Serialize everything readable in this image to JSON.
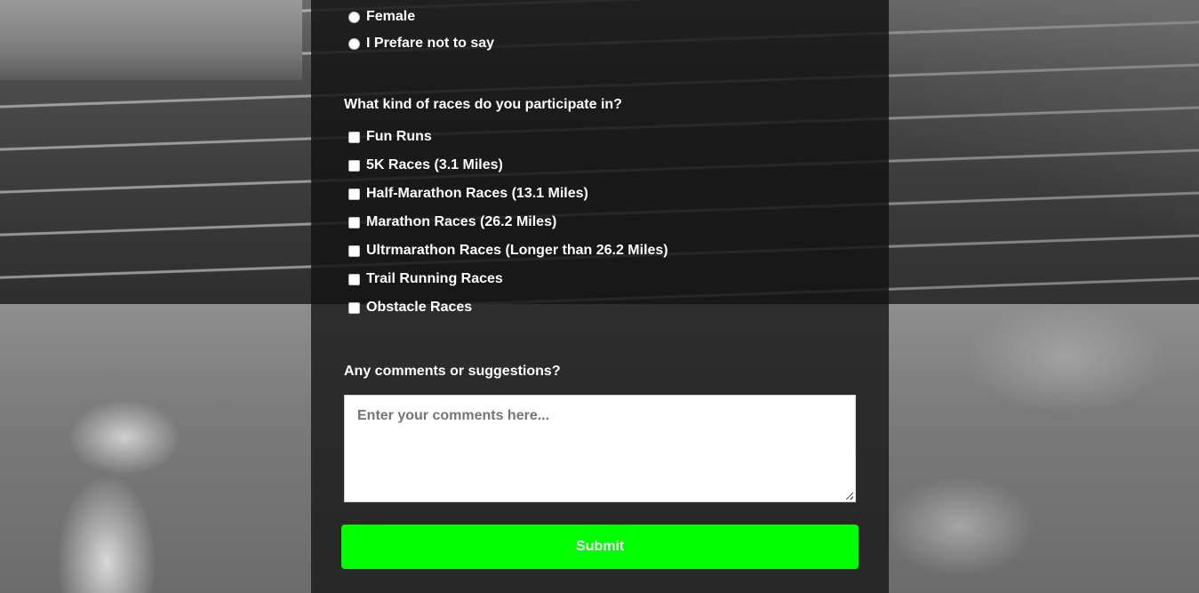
{
  "gender": {
    "options": [
      {
        "label": "Female",
        "checked": false
      },
      {
        "label": "I Prefare not to say",
        "checked": false
      }
    ]
  },
  "races": {
    "question": "What kind of races do you participate in?",
    "options": [
      {
        "label": "Fun Runs",
        "checked": false
      },
      {
        "label": "5K Races (3.1 Miles)",
        "checked": false
      },
      {
        "label": "Half-Marathon Races (13.1 Miles)",
        "checked": false
      },
      {
        "label": "Marathon Races (26.2 Miles)",
        "checked": false
      },
      {
        "label": "Ultrmarathon Races (Longer than 26.2 Miles)",
        "checked": false
      },
      {
        "label": "Trail Running Races",
        "checked": false
      },
      {
        "label": "Obstacle Races",
        "checked": false
      }
    ]
  },
  "comments": {
    "question": "Any comments or suggestions?",
    "placeholder": "Enter your comments here...",
    "value": ""
  },
  "submit": {
    "label": "Submit",
    "color": "#00ff00"
  },
  "background": {
    "icon": "running-track-photo"
  }
}
